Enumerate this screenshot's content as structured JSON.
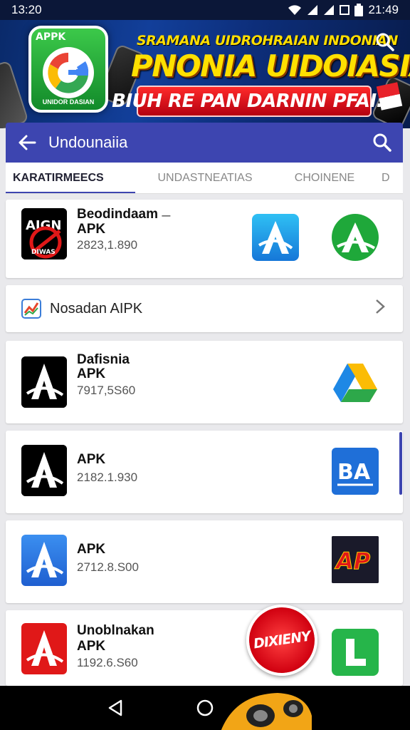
{
  "status_bar": {
    "time": "13:20",
    "right_text": "21:49"
  },
  "banner": {
    "logo_label": "APPK",
    "logo_sub": "UNIDOR DASIAN",
    "headline_small": "SRAMANA UIDROHRAIAN INDONIAN",
    "headline_big": "PNONIA UIDOIASIA!",
    "red_button": "BIUH RE PAN DARNIN PFAI..."
  },
  "app_bar": {
    "title": "Undounaiia"
  },
  "tabs": [
    {
      "label": "KARATIRMEECS",
      "active": true
    },
    {
      "label": "UNDASTNEATIAS",
      "active": false
    },
    {
      "label": "CHOINENE",
      "active": false
    },
    {
      "label": "D",
      "active": false
    }
  ],
  "featured": {
    "name_line1": "Beodindaam",
    "name_suffix": "—",
    "name_line2": "APK",
    "count": "2823,1.890"
  },
  "link_row": {
    "label": "Nosadan AIPK"
  },
  "apps": [
    {
      "name_line1": "Dafisnia",
      "name_line2": "APK",
      "count": "7917,5S60"
    },
    {
      "name_line1": "",
      "name_line2": "APK",
      "count": "2182.1.930"
    },
    {
      "name_line1": "",
      "name_line2": "APK",
      "count": "2712.8.S00"
    },
    {
      "name_line1": "Unoblnakan",
      "name_line2": "APK",
      "count": "1192.6.S60"
    }
  ],
  "sticker": {
    "label": "DIXIENY"
  },
  "icons": {
    "back": "arrow-left-icon",
    "search": "search-icon",
    "chevron": "chevron-right-icon",
    "nav": [
      "back-triangle-icon",
      "home-circle-icon",
      "recents-square-icon"
    ]
  },
  "colors": {
    "primary": "#3d45b0",
    "banner_yellow": "#ffe000",
    "banner_red": "#e8222a"
  }
}
